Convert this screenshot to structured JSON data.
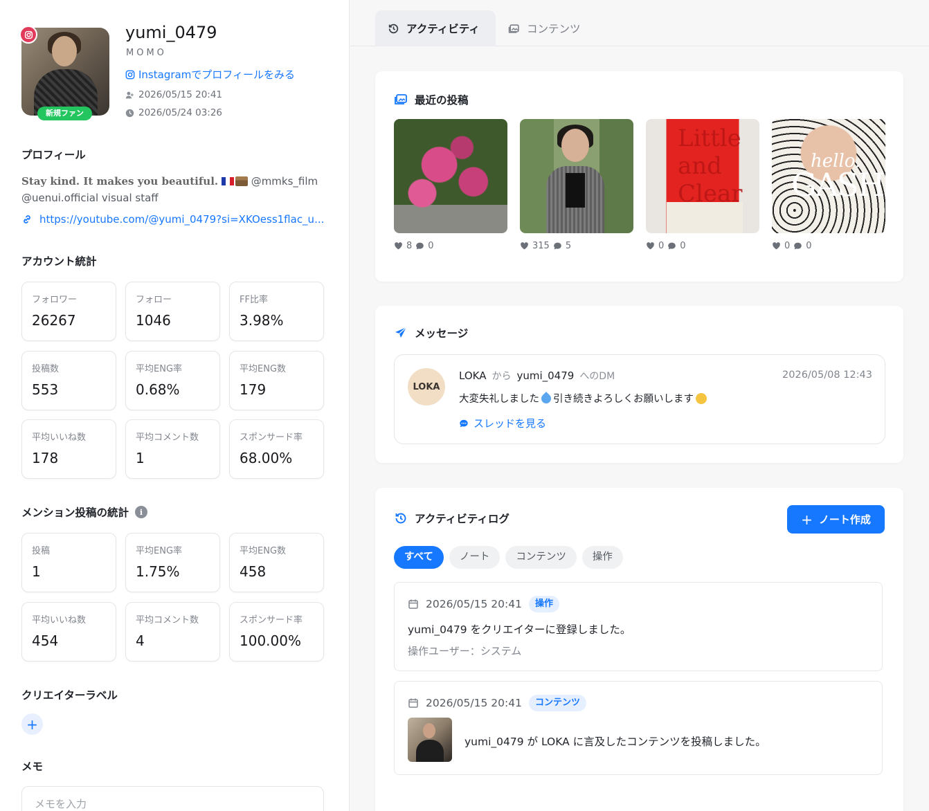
{
  "profile": {
    "username": "yumi_0479",
    "display_name": "MOMO",
    "ig_link_label": "Instagramでプロフィールをみる",
    "registered_at": "2026/05/15 20:41",
    "updated_at": "2026/05/24 03:26",
    "fan_badge": "新規ファン"
  },
  "bio": {
    "title": "プロフィール",
    "line1_text": "Stay kind. It makes you beautiful.",
    "line1_mention": "@mmks_film",
    "line2": "@uenui.official visual staff",
    "link": "https://youtube.com/@yumi_0479?si=XKOess1flac_u..."
  },
  "account_stats": {
    "title": "アカウント統計",
    "items": [
      {
        "label": "フォロワー",
        "value": "26267"
      },
      {
        "label": "フォロー",
        "value": "1046"
      },
      {
        "label": "FF比率",
        "value": "3.98%"
      },
      {
        "label": "投稿数",
        "value": "553"
      },
      {
        "label": "平均ENG率",
        "value": "0.68%"
      },
      {
        "label": "平均ENG数",
        "value": "179"
      },
      {
        "label": "平均いいね数",
        "value": "178"
      },
      {
        "label": "平均コメント数",
        "value": "1"
      },
      {
        "label": "スポンサード率",
        "value": "68.00%"
      }
    ]
  },
  "mention_stats": {
    "title": "メンション投稿の統計",
    "info_icon": "i",
    "items": [
      {
        "label": "投稿",
        "value": "1"
      },
      {
        "label": "平均ENG率",
        "value": "1.75%"
      },
      {
        "label": "平均ENG数",
        "value": "458"
      },
      {
        "label": "平均いいね数",
        "value": "454"
      },
      {
        "label": "平均コメント数",
        "value": "4"
      },
      {
        "label": "スポンサード率",
        "value": "100.00%"
      }
    ]
  },
  "creator_label": {
    "title": "クリエイターラベル",
    "add": "+"
  },
  "memo": {
    "title": "メモ",
    "placeholder": "メモを入力"
  },
  "tabs": {
    "activity": "アクティビティ",
    "content": "コンテンツ"
  },
  "recent_posts": {
    "title": "最近の投稿",
    "posts": [
      {
        "likes": "8",
        "comments": "0"
      },
      {
        "likes": "315",
        "comments": "5"
      },
      {
        "likes": "0",
        "comments": "0",
        "image_text": "Little and Clear"
      },
      {
        "likes": "0",
        "comments": "0",
        "image_text_1": "hello.",
        "image_text_2": "GASH"
      }
    ]
  },
  "messages": {
    "title": "メッセージ",
    "sender_avatar": "LOKA",
    "sender": "LOKA",
    "from_word": "から",
    "recipient": "yumi_0479",
    "dm_suffix": "へのDM",
    "date": "2026/05/08 12:43",
    "body_a": "大変失礼しました",
    "body_b": "引き続きよろしくお願いします",
    "thread_link": "スレッドを見る"
  },
  "activity_log": {
    "title": "アクティビティログ",
    "note_button": "ノート作成",
    "filters": [
      "すべて",
      "ノート",
      "コンテンツ",
      "操作"
    ],
    "entries": [
      {
        "date": "2026/05/15 20:41",
        "tag": "操作",
        "text": "yumi_0479 をクリエイターに登録しました。",
        "sub": "操作ユーザー：システム"
      },
      {
        "date": "2026/05/15 20:41",
        "tag": "コンテンツ",
        "text": "yumi_0479 が LOKA に言及したコンテンツを投稿しました。"
      }
    ]
  },
  "colors": {
    "accent": "#1677ff",
    "badge_green": "#22c55e",
    "ig_pink": "#e23a5a"
  }
}
